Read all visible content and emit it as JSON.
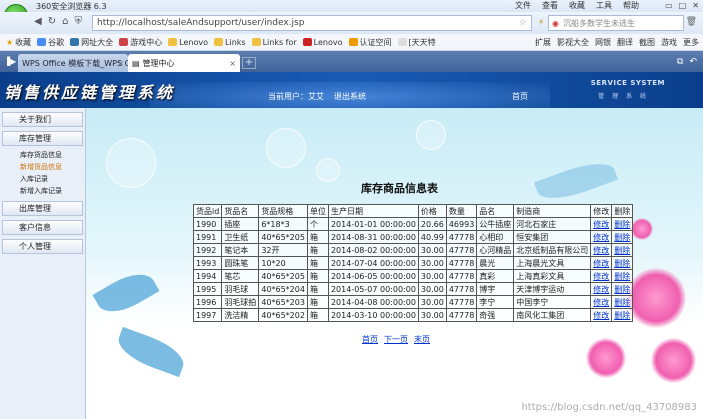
{
  "browser": {
    "title": "360安全浏览器 6.3",
    "menu": [
      "文件",
      "查看",
      "收藏",
      "工具",
      "帮助"
    ],
    "url": "http://localhost/saleAndsupport/user/index.jsp",
    "search_placeholder": "沉船多数学生未逃生",
    "bookmarks": [
      "收藏",
      "谷歌",
      "网址大全",
      "游戏中心",
      "Lenovo",
      "Links",
      "Links for",
      "Lenovo",
      "认证空间",
      "[天天特"
    ],
    "bookmarks_right": [
      "扩展",
      "影视大全",
      "网银",
      "翻译",
      "截图",
      "游戏",
      "更多"
    ],
    "tabs": [
      {
        "label": "WPS Office 模板下载_WPS O"
      },
      {
        "label": "管理中心"
      }
    ]
  },
  "app": {
    "logo_text": "销售供应链管理系统",
    "user_label": "当前用户：艾艾",
    "logout_label": "退出系统",
    "home_label": "首页",
    "service_title": "SERVICE SYSTEM",
    "service_sub": "管 理 系 统"
  },
  "menu": {
    "about": "关于我们",
    "inventory": "库存管理",
    "inventory_items": [
      "库存货品信息",
      "新增货品信息",
      "入库记录",
      "新增入库记录"
    ],
    "active_index": 1,
    "outbound": "出库管理",
    "customer": "客户信息",
    "personal": "个人管理"
  },
  "main": {
    "title": "库存商品信息表",
    "columns": [
      "货品id",
      "货品名",
      "货品规格",
      "单位",
      "生产日期",
      "价格",
      "数量",
      "品名",
      "制造商",
      "修改",
      "删除"
    ],
    "rows": [
      [
        "1990",
        "插座",
        "6*18*3",
        "个",
        "2014-01-01 00:00:00",
        "20.66",
        "46993",
        "公牛插座",
        "河北石家庄",
        "修改",
        "删除"
      ],
      [
        "1991",
        "卫生纸",
        "40*65*205",
        "箱",
        "2014-08-31 00:00:00",
        "40.99",
        "47778",
        "心相印",
        "恒安集团",
        "修改",
        "删除"
      ],
      [
        "1992",
        "笔记本",
        "32开",
        "箱",
        "2014-08-02 00:00:00",
        "30.00",
        "47778",
        "心河精品",
        "北京纸制品有限公司",
        "修改",
        "删除"
      ],
      [
        "1993",
        "圆珠笔",
        "10*20",
        "箱",
        "2014-07-04 00:00:00",
        "30.00",
        "47778",
        "晨光",
        "上海晨光文具",
        "修改",
        "删除"
      ],
      [
        "1994",
        "笔芯",
        "40*65*205",
        "箱",
        "2014-06-05 00:00:00",
        "30.00",
        "47778",
        "真彩",
        "上海真彩文具",
        "修改",
        "删除"
      ],
      [
        "1995",
        "羽毛球",
        "40*65*204",
        "箱",
        "2014-05-07 00:00:00",
        "30.00",
        "47778",
        "博宇",
        "天津博宇运动",
        "修改",
        "删除"
      ],
      [
        "1996",
        "羽毛球拍",
        "40*65*203",
        "箱",
        "2014-04-08 00:00:00",
        "30.00",
        "47778",
        "李宁",
        "中国李宁",
        "修改",
        "删除"
      ],
      [
        "1997",
        "洗洁精",
        "40*65*202",
        "箱",
        "2014-03-10 00:00:00",
        "30.00",
        "47778",
        "奇强",
        "南风化工集团",
        "修改",
        "删除"
      ]
    ],
    "pager": [
      "首页",
      "下一页",
      "末页"
    ]
  },
  "watermark": "https://blog.csdn.net/qq_43708983"
}
